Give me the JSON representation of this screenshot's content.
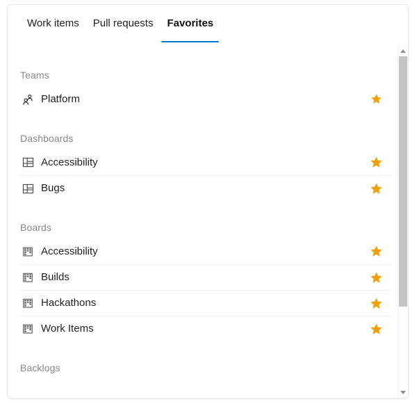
{
  "colors": {
    "accent": "#0078d4",
    "star": "#f2a007",
    "section_header_text": "#8a8886",
    "item_text": "#1f1f1f",
    "separator": "#f0f0f0",
    "card_border": "#e6e6e6",
    "scrollbar_thumb": "#c3c3c3",
    "background": "#ffffff"
  },
  "tabs": [
    {
      "label": "Work items",
      "active": false
    },
    {
      "label": "Pull requests",
      "active": false
    },
    {
      "label": "Favorites",
      "active": true
    }
  ],
  "sections": [
    {
      "header": "Teams",
      "items": [
        {
          "label": "Platform",
          "icon": "team-members-icon",
          "starred": true,
          "star_icon": "star-filled-icon"
        }
      ]
    },
    {
      "header": "Dashboards",
      "items": [
        {
          "label": "Accessibility",
          "icon": "dashboard-icon",
          "starred": true,
          "star_icon": "star-filled-icon"
        },
        {
          "label": "Bugs",
          "icon": "dashboard-icon",
          "starred": true,
          "star_icon": "star-filled-icon"
        }
      ]
    },
    {
      "header": "Boards",
      "items": [
        {
          "label": "Accessibility",
          "icon": "board-icon",
          "starred": true,
          "star_icon": "star-filled-icon"
        },
        {
          "label": "Builds",
          "icon": "board-icon",
          "starred": true,
          "star_icon": "star-filled-icon"
        },
        {
          "label": "Hackathons",
          "icon": "board-icon",
          "starred": true,
          "star_icon": "star-filled-icon"
        },
        {
          "label": "Work Items",
          "icon": "board-icon",
          "starred": true,
          "star_icon": "star-filled-icon"
        }
      ]
    },
    {
      "header": "Backlogs",
      "items": []
    }
  ],
  "scrollbar": {
    "up_arrow": "scroll-up-arrow-icon",
    "down_arrow": "scroll-down-arrow-icon",
    "thumb": "scrollbar-thumb"
  }
}
